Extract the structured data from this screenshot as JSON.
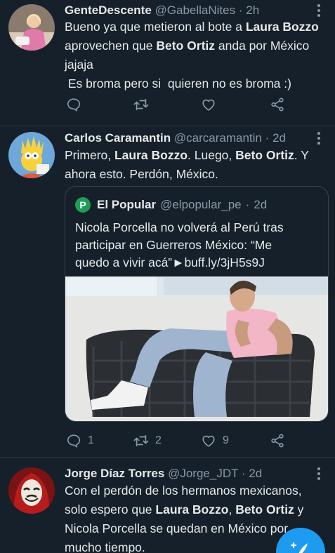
{
  "tweets": [
    {
      "name": "GenteDescente",
      "handle": "@GabellaNites",
      "sep": "·",
      "time": "2h",
      "lines": [
        {
          "a": "Bueno ya que metieron al bote a ",
          "b": "Laura Bozzo",
          "c": ""
        },
        {
          "a": "aprovechen que ",
          "b": "Beto Ortiz",
          "c": " anda por México"
        },
        {
          "a": "jajaja",
          "b": "",
          "c": ""
        },
        {
          "a": " Es broma pero si  quieren no es broma :)",
          "b": "",
          "c": ""
        }
      ],
      "counts": {
        "reply": "",
        "retweet": "",
        "like": ""
      }
    },
    {
      "name": "Carlos Caramantin",
      "handle": "@carcaramantin",
      "sep": "·",
      "time": "2d",
      "lines": [
        {
          "a": "Primero, ",
          "b": "Laura Bozzo",
          "c": ". Luego, ",
          "d": "Beto Ortiz",
          "e": ". Y"
        },
        {
          "a": "ahora esto. Perdón, México.",
          "b": "",
          "c": ""
        }
      ],
      "quote": {
        "logo": "P",
        "name": "El Popular",
        "handle": "@elpopular_pe",
        "sep": "·",
        "time": "2d",
        "lines": [
          "Nicola Porcella no volverá al Perú tras",
          "participar en Guerreros México: “Me",
          "quedo a vivir acá”►buff.ly/3jH5s9J"
        ]
      },
      "counts": {
        "reply": "1",
        "retweet": "2",
        "like": "9"
      }
    },
    {
      "name": "Jorge Díaz Torres",
      "handle": "@Jorge_JDT",
      "sep": "·",
      "time": "2d",
      "lines": [
        {
          "a": "Con el perdón de los hermanos mexicanos,",
          "b": "",
          "c": ""
        },
        {
          "a": "solo espero que ",
          "b": "Laura Bozzo",
          "c": ", ",
          "d": "Beto Ortiz",
          "e": " y"
        },
        {
          "a": "Nicola Porcella se quedan en México por",
          "b": "",
          "c": ""
        },
        {
          "a": "mucho tiempo.",
          "b": "",
          "c": ""
        }
      ]
    }
  ],
  "fab": {
    "icon": "compose-tweet-icon"
  }
}
